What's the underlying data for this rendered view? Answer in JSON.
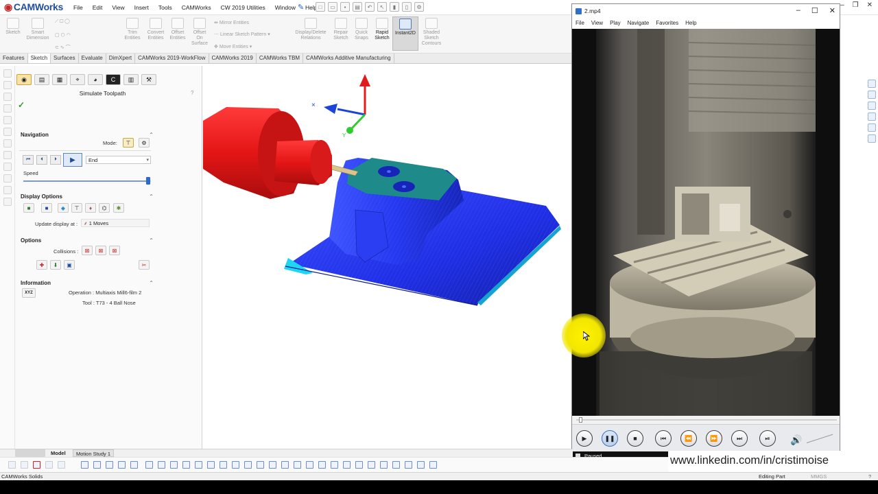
{
  "app": {
    "logo": "CAMWorks",
    "menu": [
      "File",
      "Edit",
      "View",
      "Insert",
      "Tools",
      "CAMWorks",
      "CW 2019 Utilities",
      "Window",
      "Help"
    ]
  },
  "command_manager": {
    "sketch": "Sketch",
    "smart_dimension": [
      "Smart",
      "Dimension"
    ],
    "trim_entities": [
      "Trim",
      "Entities"
    ],
    "convert_entities": [
      "Convert",
      "Entities"
    ],
    "offset_entities": [
      "Offset",
      "Entities"
    ],
    "offset_on_surface": [
      "Offset",
      "On",
      "Surface"
    ],
    "mirror_entities": "Mirror Entities",
    "linear_sketch_pattern": "Linear Sketch Pattern",
    "move_entities": "Move Entities",
    "display_delete_relations": [
      "Display/Delete",
      "Relations"
    ],
    "repair_sketch": [
      "Repair",
      "Sketch"
    ],
    "quick_snaps": [
      "Quick",
      "Snaps"
    ],
    "rapid_sketch": [
      "Rapid",
      "Sketch"
    ],
    "instant2d": "Instant2D",
    "shaded_sketch_contours": [
      "Shaded",
      "Sketch",
      "Contours"
    ]
  },
  "tabs": [
    "Features",
    "Sketch",
    "Surfaces",
    "Evaluate",
    "DimXpert",
    "CAMWorks 2019-WorkFlow",
    "CAMWorks 2019",
    "CAMWorks TBM",
    "CAMWorks Additive Manufacturing"
  ],
  "active_tab": "Sketch",
  "property_manager": {
    "title": "Simulate Toolpath",
    "help": "?",
    "navigation": {
      "header": "Navigation",
      "mode_label": "Mode:",
      "end_select": "End",
      "speed_label": "Speed",
      "speed_level": 0.98
    },
    "display_options": {
      "header": "Display Options",
      "update_label": "Update display at :",
      "update_value": "1 Moves"
    },
    "options": {
      "header": "Options",
      "collisions_label": "Collisions :"
    },
    "information": {
      "header": "Information",
      "xyz_button": "XYZ",
      "operation": "Operation :  Multiaxis Mill6-film 2",
      "tool": "Tool :  T73 - 4 Ball Nose"
    }
  },
  "media_player": {
    "title": "2.mp4",
    "menu": [
      "File",
      "View",
      "Play",
      "Navigate",
      "Favorites",
      "Help"
    ],
    "status": "Paused",
    "seek_position": 0.01
  },
  "bottom": {
    "model_tabs": [
      "Model",
      "Motion Study 1"
    ],
    "status_left": "CAMWorks Solids",
    "status_editing": "Editing Part",
    "status_units": "MMGS",
    "linkedin": "www.linkedin.com/in/cristimoise"
  },
  "colors": {
    "spindle": "#e01919",
    "part": "#1a2ee0",
    "part_top": "#1f8a8a",
    "fixture": "#16a8c9",
    "axis_z": "#e11b1b",
    "axis_x": "#1b45d8",
    "axis_y": "#2fcc2f",
    "cursor_highlight": "#fff200"
  }
}
